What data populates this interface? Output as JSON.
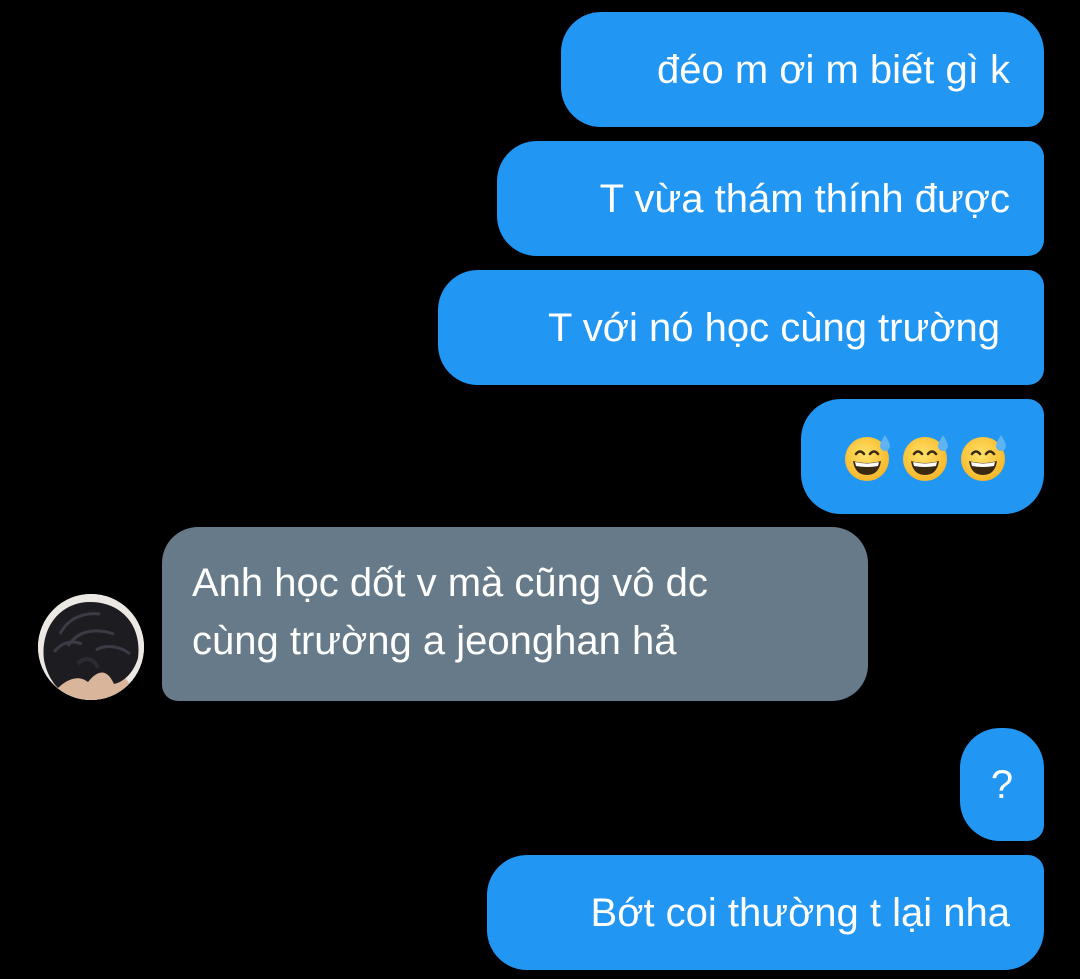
{
  "conversation": {
    "messages": [
      {
        "sender": "me",
        "text": "đéo m ơi m biết gì k"
      },
      {
        "sender": "me",
        "text": "T vừa thám thính được"
      },
      {
        "sender": "me",
        "text": "T với nó học cùng trường"
      },
      {
        "sender": "me",
        "emoji": [
          "grinning-face-with-sweat",
          "grinning-face-with-sweat",
          "grinning-face-with-sweat"
        ]
      },
      {
        "sender": "other",
        "lines": [
          "Anh học dốt v mà cũng vô dc",
          "cùng trường a jeonghan hả"
        ]
      },
      {
        "sender": "me",
        "text": "?"
      },
      {
        "sender": "me",
        "text": "Bớt coi thường t lại nha"
      }
    ]
  },
  "avatar": {
    "icon": "profile-photo-dark-hair"
  },
  "colors": {
    "background": "#000000",
    "outgoing_bubble": "#2196f3",
    "incoming_bubble": "#677a89",
    "text": "#ffffff"
  }
}
